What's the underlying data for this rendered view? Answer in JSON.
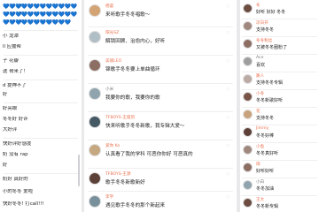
{
  "left": {
    "lines": [
      "小 龙潭",
      "ll 应援帮",
      "子 花瓣",
      "送 哥来了！",
      "d 提神不了",
      "好",
      "好亮眼",
      "冬冬好 好评",
      "大好评",
      "快好评好感度",
      "奶 没有 rap",
      "好",
      "奶好 真好的",
      "小的冬冬 爱啦",
      "快好冬冬! 打call!!!"
    ]
  },
  "mid": {
    "comments": [
      {
        "name": "杨晨",
        "text": "来听歌手冬冬唱歌～",
        "meta": "",
        "avatar_color": "#d4a373"
      },
      {
        "name": "阳光SZ",
        "text": "解锁回顾、治愈内心，好听",
        "meta": "",
        "avatar_color": "#b0bec5"
      },
      {
        "name": "美丽LEO",
        "text": "锦歌手冬冬要上单曲循环",
        "meta": "",
        "avatar_color": "#8d6e63"
      },
      {
        "name": "小米",
        "text": "我要你的歌，我要你的歌",
        "meta": "",
        "avatar_color": "#90a4ae"
      },
      {
        "name": "TFBOYS-王俊凯",
        "text": "快来听歌手冬冬新歌，我专辑大爱～",
        "meta": "",
        "avatar_color": "#455a64"
      },
      {
        "name": "爱你 Ko",
        "text": "认真看了我的学科  可恶你你好  可恶真的",
        "meta": "",
        "avatar_color": "#c5a880"
      },
      {
        "name": "TFBOYS-王源",
        "text": "歌手冬冬新歌新好",
        "meta": "",
        "avatar_color": "#5d4037"
      },
      {
        "name": "李宇",
        "text": "遇见歌手冬冬的那个新起来",
        "meta": "",
        "avatar_color": "#78909c"
      }
    ]
  },
  "right": {
    "comments": [
      {
        "name": "冬",
        "text": "好听 好好 冬冬",
        "avatar_color": "#6d4c41"
      },
      {
        "name": "凉白开",
        "text": "支持冬冬",
        "avatar_color": "#a1887f"
      },
      {
        "name": "冬冬粉丝",
        "text": "又被冬冬圈粉了",
        "avatar_color": "#8d6e63"
      },
      {
        "name": "Ace",
        "text": "喜欢",
        "avatar_color": "#9e9e9e"
      },
      {
        "name": "路人",
        "text": "支持冬冬专辑",
        "avatar_color": "#bcaaa4"
      },
      {
        "name": "小冬",
        "text": "冬冬新歌好听",
        "avatar_color": "#795548"
      },
      {
        "name": "花",
        "text": "支持冬冬",
        "avatar_color": "#c8a27c"
      },
      {
        "name": "Jimmy",
        "text": "冬冬好棒",
        "avatar_color": "#5d4037"
      },
      {
        "name": "小鱼",
        "text": "冬冬真好听",
        "avatar_color": "#a1887f"
      },
      {
        "name": "阳",
        "text": "好听好听",
        "avatar_color": "#8d6e63"
      },
      {
        "name": "小白",
        "text": "冬冬加油",
        "avatar_color": "#90a4ae"
      },
      {
        "name": "王大",
        "text": "冬冬新专辑",
        "avatar_color": "#6d4c41"
      }
    ]
  },
  "colors": {
    "blue_heart": "#2f8ae6",
    "orange_name": "#eb7350"
  }
}
